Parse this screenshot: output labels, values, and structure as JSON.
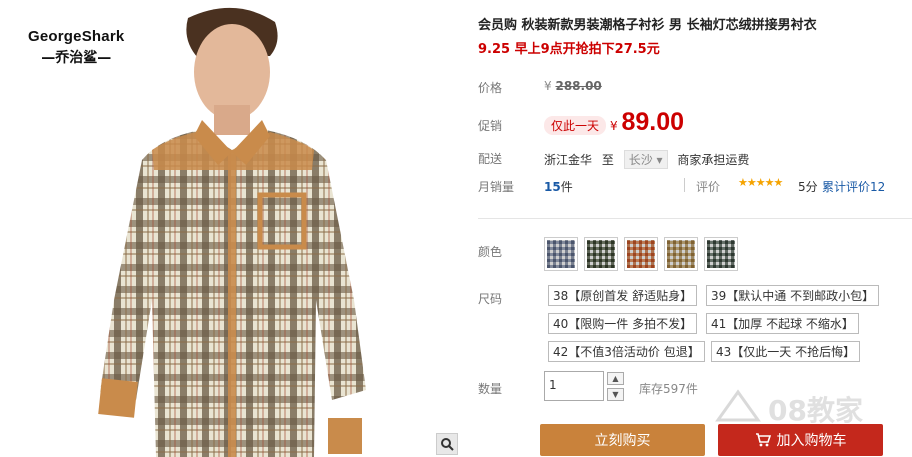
{
  "brand": {
    "name_en": "GeorgeShark",
    "name_cn": "—乔治鲨—"
  },
  "product": {
    "title": "会员购 秋装新款男装潮格子衬衫 男 长袖灯芯绒拼接男衬衣",
    "subtitle": "9.25 早上9点开抢拍下27.5元"
  },
  "price": {
    "label": "价格",
    "currency": "¥",
    "original": "288.00"
  },
  "promo": {
    "label": "促销",
    "tag": "仅此一天",
    "currency": "¥",
    "price": "89.00"
  },
  "shipping": {
    "label": "配送",
    "from": "浙江金华",
    "to_word": "至",
    "destination": "长沙",
    "note": "商家承担运费"
  },
  "sales": {
    "label": "月销量",
    "count": "15",
    "unit": "件",
    "review_label": "评价",
    "stars": "★★★★★",
    "rating": 5,
    "score_text": "5分",
    "review_link": "累计评价12"
  },
  "colors": {
    "label": "颜色",
    "swatches": [
      {
        "name": "grey-blue-plaid",
        "color": "#8a93a6"
      },
      {
        "name": "dark-green-plaid",
        "color": "#6b7462"
      },
      {
        "name": "orange-plaid",
        "color": "#c8845a"
      },
      {
        "name": "khaki-plaid",
        "color": "#b59e72"
      },
      {
        "name": "grey-green-plaid",
        "color": "#6c7870"
      }
    ]
  },
  "sizes": {
    "label": "尺码",
    "options": [
      "38【原创首发 舒适贴身】",
      "39【默认中通 不到邮政小包】",
      "40【限购一件 多拍不发】",
      "41【加厚 不起球 不缩水】",
      "42【不值3倍活动价 包退】",
      "43【仅此一天 不抢后悔】"
    ]
  },
  "quantity": {
    "label": "数量",
    "value": "1",
    "stock": "库存597件"
  },
  "buttons": {
    "buy": "立刻购买",
    "cart": "加入购物车"
  },
  "watermark": "08教家",
  "accent": {
    "red": "#c00",
    "buy": "#c9823b",
    "cart": "#c4281c",
    "link": "#1a5aa6"
  }
}
